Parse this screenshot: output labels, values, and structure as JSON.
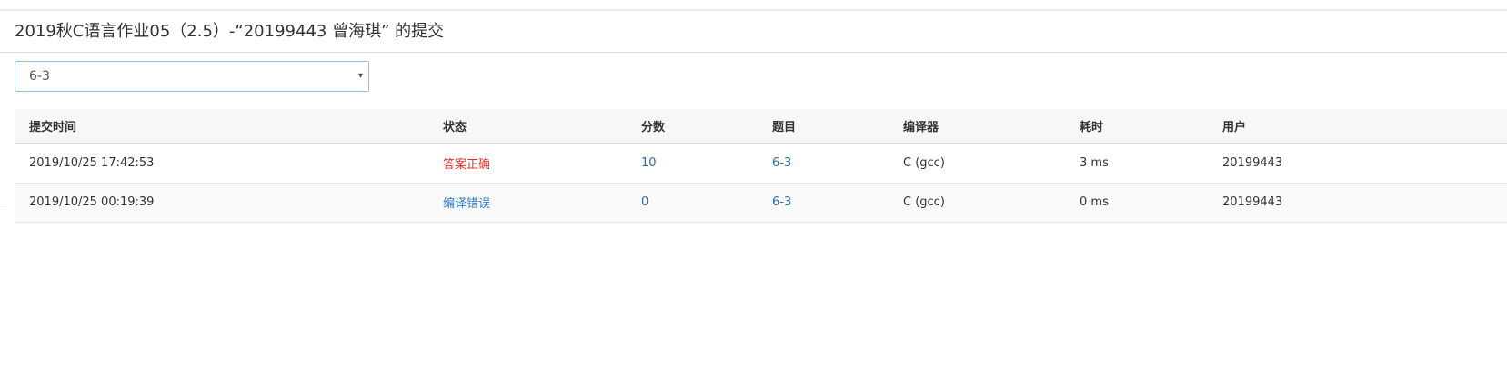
{
  "page": {
    "title": "2019秋C语言作业05（2.5）-“20199443 曾海琪” 的提交"
  },
  "filter": {
    "selected_problem": "6-3",
    "caret": "▾"
  },
  "table": {
    "headers": {
      "time": "提交时间",
      "status": "状态",
      "score": "分数",
      "problem": "题目",
      "compiler": "编译器",
      "elapsed": "耗时",
      "user": "用户"
    },
    "rows": [
      {
        "time": "2019/10/25 17:42:53",
        "status": "答案正确",
        "score": "10",
        "problem": "6-3",
        "compiler": "C (gcc)",
        "elapsed": "3 ms",
        "user": "20199443"
      },
      {
        "time": "2019/10/25 00:19:39",
        "status": "编译错误",
        "score": "0",
        "problem": "6-3",
        "compiler": "C (gcc)",
        "elapsed": "0 ms",
        "user": "20199443"
      }
    ]
  },
  "colors": {
    "accepted": "#e2342e",
    "compile_error": "#2f7cd1",
    "link": "#2a6db0"
  }
}
